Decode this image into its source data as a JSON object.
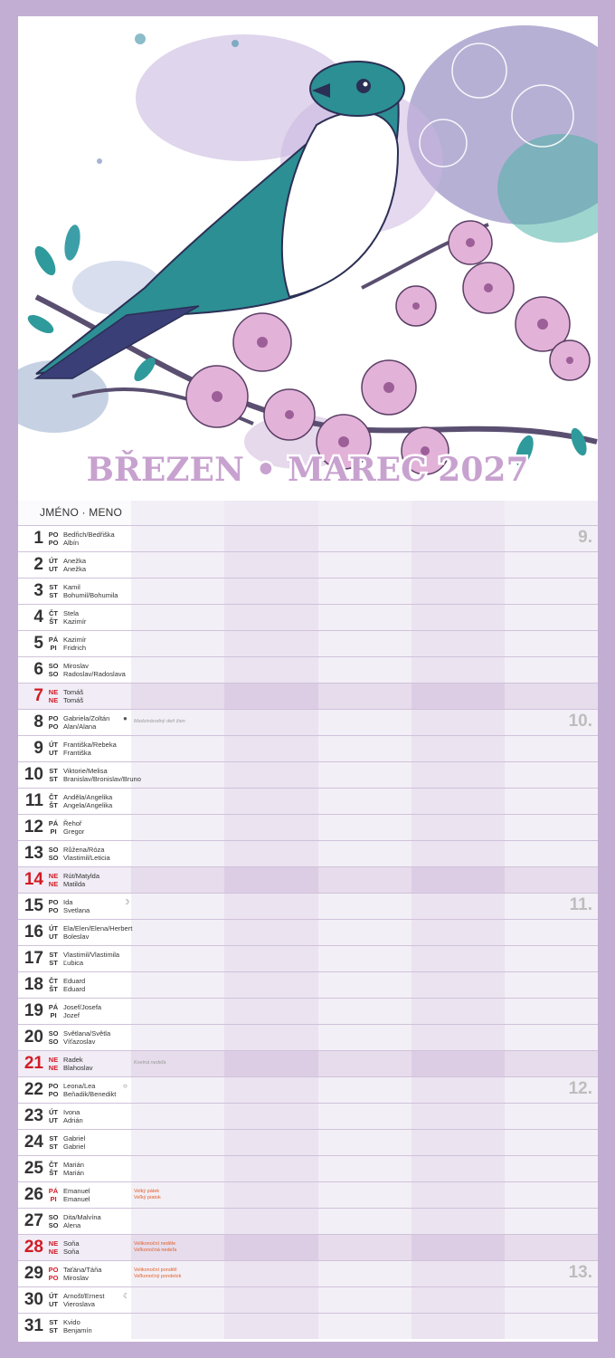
{
  "calendar": {
    "title": "BŘEZEN • MAREC 2027",
    "header_label": "JMÉNO · MENO"
  },
  "colors": {
    "frame": "#c3aed3",
    "sunday_red": "#d11b24",
    "holiday_orange": "#e0602a",
    "week_gray": "#bdbdbd",
    "bird_teal": "#2e8f93",
    "blossom_pink": "#d9a3cf"
  },
  "days": [
    {
      "day": "1",
      "cz": "PO",
      "sk": "PO",
      "name_cz": "Bedřich/Bedřiška",
      "name_sk": "Albín",
      "week": "9."
    },
    {
      "day": "2",
      "cz": "ÚT",
      "sk": "UT",
      "name_cz": "Anežka",
      "name_sk": "Anežka"
    },
    {
      "day": "3",
      "cz": "ST",
      "sk": "ST",
      "name_cz": "Kamil",
      "name_sk": "Bohumil/Bohumila"
    },
    {
      "day": "4",
      "cz": "ČT",
      "sk": "ŠT",
      "name_cz": "Stela",
      "name_sk": "Kazimír"
    },
    {
      "day": "5",
      "cz": "PÁ",
      "sk": "PI",
      "name_cz": "Kazimír",
      "name_sk": "Fridrich"
    },
    {
      "day": "6",
      "cz": "SO",
      "sk": "SO",
      "name_cz": "Miroslav",
      "name_sk": "Radoslav/Radoslava"
    },
    {
      "day": "7",
      "cz": "NE",
      "sk": "NE",
      "name_cz": "Tomáš",
      "name_sk": "Tomáš",
      "sunday": true
    },
    {
      "day": "8",
      "cz": "PO",
      "sk": "PO",
      "name_cz": "Gabriela/Zoltán",
      "name_sk": "Alan/Alana",
      "week": "10.",
      "moon": "●",
      "note": "Medzinárodný deň žien"
    },
    {
      "day": "9",
      "cz": "ÚT",
      "sk": "UT",
      "name_cz": "Františka/Rebeka",
      "name_sk": "Františka"
    },
    {
      "day": "10",
      "cz": "ST",
      "sk": "ST",
      "name_cz": "Viktorie/Melisa",
      "name_sk": "Branislav/Bronislav/Bruno"
    },
    {
      "day": "11",
      "cz": "ČT",
      "sk": "ŠT",
      "name_cz": "Anděla/Angelika",
      "name_sk": "Angela/Angelika"
    },
    {
      "day": "12",
      "cz": "PÁ",
      "sk": "PI",
      "name_cz": "Řehoř",
      "name_sk": "Gregor"
    },
    {
      "day": "13",
      "cz": "SO",
      "sk": "SO",
      "name_cz": "Růžena/Róza",
      "name_sk": "Vlastimil/Leticia"
    },
    {
      "day": "14",
      "cz": "NE",
      "sk": "NE",
      "name_cz": "Rút/Matylda",
      "name_sk": "Matilda",
      "sunday": true
    },
    {
      "day": "15",
      "cz": "PO",
      "sk": "PO",
      "name_cz": "Ida",
      "name_sk": "Svetlana",
      "week": "11.",
      "moon": "☽"
    },
    {
      "day": "16",
      "cz": "ÚT",
      "sk": "UT",
      "name_cz": "Ela/Elen/Elena/Herbert",
      "name_sk": "Boleslav"
    },
    {
      "day": "17",
      "cz": "ST",
      "sk": "ST",
      "name_cz": "Vlastimil/Vlastimila",
      "name_sk": "Ľubica"
    },
    {
      "day": "18",
      "cz": "ČT",
      "sk": "ŠT",
      "name_cz": "Eduard",
      "name_sk": "Eduard"
    },
    {
      "day": "19",
      "cz": "PÁ",
      "sk": "PI",
      "name_cz": "Josef/Josefa",
      "name_sk": "Jozef"
    },
    {
      "day": "20",
      "cz": "SO",
      "sk": "SO",
      "name_cz": "Světlana/Světla",
      "name_sk": "Víťazoslav"
    },
    {
      "day": "21",
      "cz": "NE",
      "sk": "NE",
      "name_cz": "Radek",
      "name_sk": "Blahoslav",
      "sunday": true,
      "note": "Kvetná nedeľa"
    },
    {
      "day": "22",
      "cz": "PO",
      "sk": "PO",
      "name_cz": "Leona/Lea",
      "name_sk": "Beňadik/Benedikt",
      "week": "12.",
      "moon": "○"
    },
    {
      "day": "23",
      "cz": "ÚT",
      "sk": "UT",
      "name_cz": "Ivona",
      "name_sk": "Adrián"
    },
    {
      "day": "24",
      "cz": "ST",
      "sk": "ST",
      "name_cz": "Gabriel",
      "name_sk": "Gabriel"
    },
    {
      "day": "25",
      "cz": "ČT",
      "sk": "ŠT",
      "name_cz": "Marián",
      "name_sk": "Marián"
    },
    {
      "day": "26",
      "cz": "PÁ",
      "sk": "PI",
      "name_cz": "Emanuel",
      "name_sk": "Emanuel",
      "holiday": true,
      "hol_cz": "Velký pátek",
      "hol_sk": "Veľký piatok"
    },
    {
      "day": "27",
      "cz": "SO",
      "sk": "SO",
      "name_cz": "Dita/Malvína",
      "name_sk": "Alena"
    },
    {
      "day": "28",
      "cz": "NE",
      "sk": "NE",
      "name_cz": "Soňa",
      "name_sk": "Soňa",
      "sunday": true,
      "hol_cz": "Velikonoční neděle",
      "hol_sk": "Veľkonočná nedeľa"
    },
    {
      "day": "29",
      "cz": "PO",
      "sk": "PO",
      "name_cz": "Taťána/Táňa",
      "name_sk": "Miroslav",
      "week": "13.",
      "holiday": true,
      "hol_cz": "Velikonoční pondělí",
      "hol_sk": "Veľkonočný pondelok"
    },
    {
      "day": "30",
      "cz": "ÚT",
      "sk": "UT",
      "name_cz": "Arnošt/Ernest",
      "name_sk": "Vieroslava",
      "moon": "☾"
    },
    {
      "day": "31",
      "cz": "ST",
      "sk": "ST",
      "name_cz": "Kvido",
      "name_sk": "Benjamín"
    }
  ]
}
